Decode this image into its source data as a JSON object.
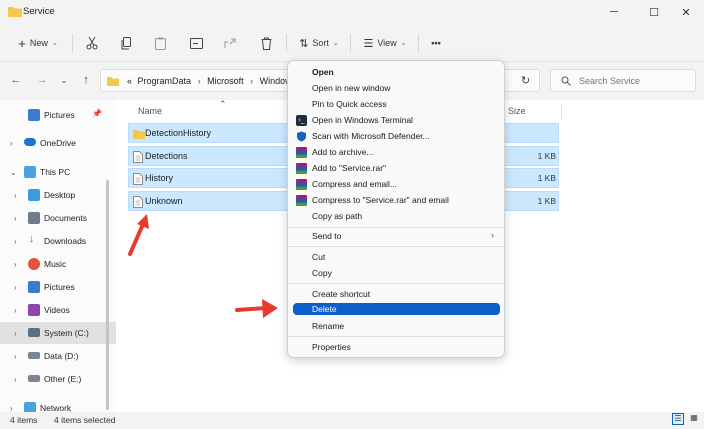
{
  "window": {
    "title": "Service",
    "minimize": "─",
    "maximize": "☐",
    "close": "✕"
  },
  "toolbar": {
    "new_label": "New",
    "sort_label": "Sort",
    "view_label": "View",
    "more_label": "•••"
  },
  "address": {
    "overflow": "«",
    "crumbs": [
      "ProgramData",
      "Microsoft",
      "Window"
    ]
  },
  "search": {
    "placeholder": "Search Service"
  },
  "sidebar": {
    "items": [
      {
        "label": "Pictures",
        "icon": "pictures-icon"
      },
      {
        "label": "OneDrive",
        "icon": "onedrive-icon"
      },
      {
        "label": "This PC",
        "icon": "this-pc-icon"
      },
      {
        "label": "Desktop",
        "icon": "desktop-icon"
      },
      {
        "label": "Documents",
        "icon": "documents-icon"
      },
      {
        "label": "Downloads",
        "icon": "downloads-icon"
      },
      {
        "label": "Music",
        "icon": "music-icon"
      },
      {
        "label": "Pictures",
        "icon": "pictures-icon"
      },
      {
        "label": "Videos",
        "icon": "videos-icon"
      },
      {
        "label": "System (C:)",
        "icon": "drive-icon"
      },
      {
        "label": "Data (D:)",
        "icon": "drive-icon"
      },
      {
        "label": "Other (E:)",
        "icon": "drive-icon"
      },
      {
        "label": "Network",
        "icon": "network-icon"
      }
    ]
  },
  "columns": {
    "name": "Name",
    "size": "Size"
  },
  "files": [
    {
      "name": "DetectionHistory",
      "type": "folder",
      "size": ""
    },
    {
      "name": "Detections",
      "type": "file",
      "size": "1 KB"
    },
    {
      "name": "History",
      "type": "file",
      "size": "1 KB"
    },
    {
      "name": "Unknown",
      "type": "file",
      "size": "1 KB"
    }
  ],
  "status": {
    "item_count": "4 items",
    "selected": "4 items selected"
  },
  "context_menu": {
    "items": [
      {
        "label": "Open",
        "icon": "",
        "bold": true
      },
      {
        "label": "Open in new window",
        "icon": ""
      },
      {
        "label": "Pin to Quick access",
        "icon": ""
      },
      {
        "label": "Open in Windows Terminal",
        "icon": "terminal-icon"
      },
      {
        "label": "Scan with Microsoft Defender...",
        "icon": "defender-shield-icon"
      },
      {
        "label": "Add to archive...",
        "icon": "winrar-icon"
      },
      {
        "label": "Add to \"Service.rar\"",
        "icon": "winrar-icon"
      },
      {
        "label": "Compress and email...",
        "icon": "winrar-icon"
      },
      {
        "label": "Compress to \"Service.rar\" and email",
        "icon": "winrar-icon"
      },
      {
        "label": "Copy as path",
        "icon": ""
      },
      {
        "label": "Send to",
        "icon": "",
        "submenu": true
      },
      {
        "label": "Cut",
        "icon": ""
      },
      {
        "label": "Copy",
        "icon": ""
      },
      {
        "label": "Create shortcut",
        "icon": ""
      },
      {
        "label": "Delete",
        "icon": "",
        "highlighted": true
      },
      {
        "label": "Rename",
        "icon": ""
      },
      {
        "label": "Properties",
        "icon": ""
      }
    ],
    "submenu_arrow": "›"
  },
  "colors": {
    "selection": "#cce8ff",
    "menu_highlight": "#0a5fc8",
    "annotation_arrow": "#e8392c",
    "folder": "#f2c94c"
  }
}
